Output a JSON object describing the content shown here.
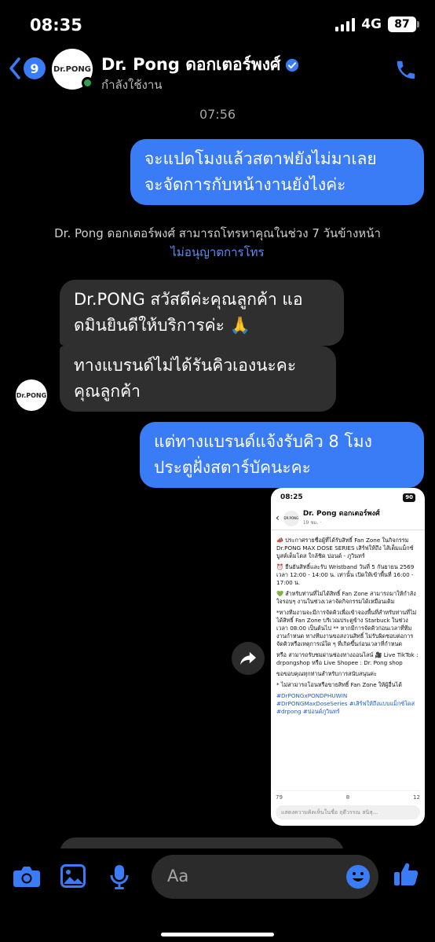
{
  "status_bar": {
    "time": "08:35",
    "network": "4G",
    "battery": "87"
  },
  "header": {
    "back_count": "9",
    "avatar_text": "Dr.PONG",
    "name": "Dr. Pong ดอกเตอร์พงศ์",
    "status": "กำลังใช้งาน"
  },
  "timestamp": "07:56",
  "messages": {
    "out1_line1": "จะแปดโมงแล้วสตาฟยังไม่มาเลย",
    "out1_line2": "จะจัดการกับหน้างานยังไงค่ะ",
    "notice": "Dr. Pong ดอกเตอร์พงศ์ สามารถโทรหาคุณในช่วง 7 วันข้างหน้า",
    "notice_link": "ไม่อนุญาตการโทร",
    "in1_line1": "Dr.PONG สวัสดีค่ะคุณลูกค้า แอ",
    "in1_line2": "ดมินยินดีให้บริการค่ะ 🙏",
    "in2_line1": "ทางแบรนด์ไม่ได้รันคิวเองนะคะ",
    "in2_line2": "คุณลูกค้า",
    "out2_line1": "แต่ทางแบรนด์แจ้งรับคิว 8 โมง",
    "out2_line2": "ประตูฝั่งสตาร์บัคนะคะ",
    "small_avatar_text": "Dr.PONG"
  },
  "shared_post": {
    "time": "08:25",
    "battery": "90",
    "page_name": "Dr. Pong ดอกเตอร์พงศ์",
    "post_time": "19 ชม. ·",
    "p1": "📣 ประกาศรายชื่อผู้ที่ได้รับสิทธิ์ Fan Zone ในกิจกรรม Dr.PONG MAX DOSE SERIES เสิร์ฟให้ถึง ไส้เต็มแม็กซ์ บูสต์เต็มโดส ใกล้ชิด ปอนด์ - ภูวินทร์",
    "p2": "⏰ ยืนยันสิทธิ์และรับ Wristband วันที่ 5 กันยายน 2569 เวลา 12:00 - 14:00 น. เท่านั้น เปิดให้เข้าพื้นที่ 16:00 - 17:00 น.",
    "p3": "💚 สำหรับท่านที่ไม่ได้สิทธิ์ Fan Zone สามารถมาให้กำลังใจรอบๆ งานในช่วงเวลาจัดกิจกรรมได้เหมือนเดิม",
    "p4": "*ทางทีมงานจะมีการจัดคิวเพื่อเข้าจองพื้นที่สำหรับท่านที่ไม่ได้สิทธิ์ Fan Zone บริเวณประตูข้าง Starbuck ในช่วงเวลา 08:00 เป็นต้นไป ** หากมีการจัดคิวก่อนเวลาที่ทีมงานกำหนด ทางทีมงานขอสงวนสิทธิ์ ไม่รับผิดชอบต่อการจัดคิวหรือเหตุการณ์ใด ๆ ที่เกิดขึ้นก่อนเวลาที่กำหนด",
    "p5": "หรือ สามารถรับชมผ่านช่องทางออนไลน์ 🎥 Live TikTok : drpongshop หรือ Live Shopee : Dr. Pong shop",
    "p6": "ขอขอบคุณทุกท่านสำหรับการสนับสนุนค่ะ",
    "p7": "* ไม่สามารถโอนหรือขายสิทธิ์ Fan Zone ให้ผู้อื่นได้",
    "tags": "#DrPONGxPONDPHUWIN #DrPONGMaxDoseSeries #เสิร์ฟให้ถึงแบบแม็กซ์โดส #drpong #ปอนด์ภูวินทร์",
    "likes": "79",
    "comments": "8",
    "shares": "12",
    "comment_placeholder": "แสดงความคิดเห็นในชื่อ ฤดีวรรณ สนิสุ..."
  },
  "composer": {
    "placeholder": "Aa"
  },
  "colors": {
    "accent": "#3a7bf6",
    "incoming_bubble": "#2f2f2f",
    "background": "#000000"
  }
}
